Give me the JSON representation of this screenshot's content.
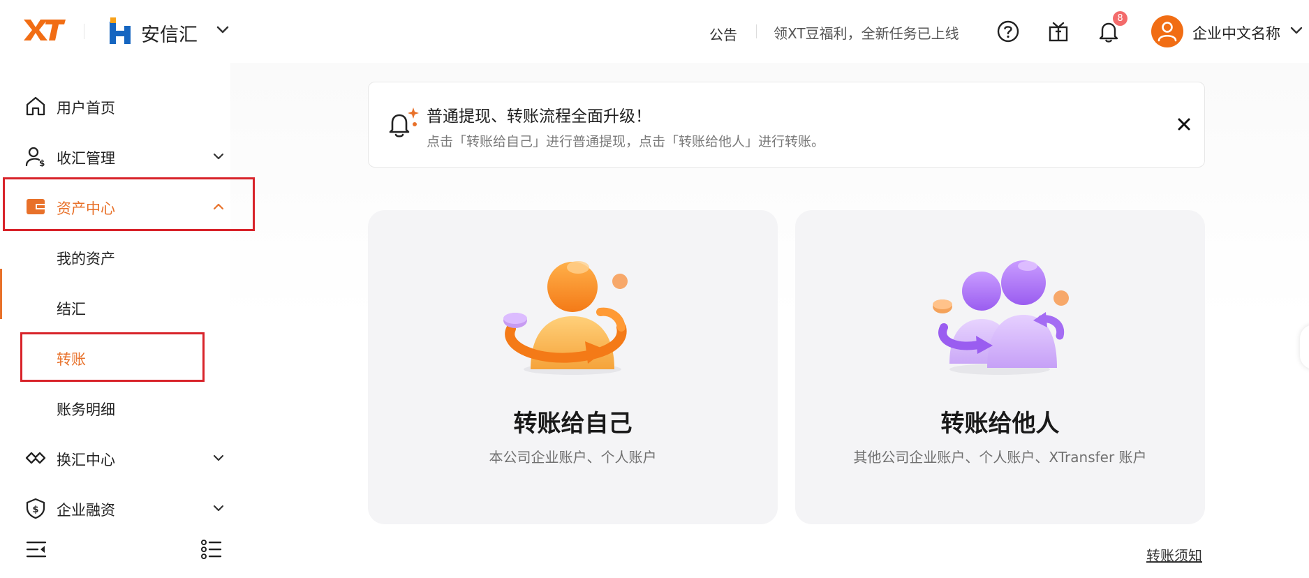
{
  "header": {
    "logo_text": "XT",
    "brand_name": "安信汇",
    "notice_link": "公告",
    "promo_link": "领XT豆福利，全新任务已上线",
    "notification_count": "8",
    "company_name": "企业中文名称"
  },
  "icons": {
    "help": "question-circle-icon",
    "gift": "gift-icon",
    "notifications": "bell-icon",
    "avatar": "user-icon"
  },
  "sidebar": {
    "items": [
      {
        "label": "用户首页",
        "icon": "home-icon"
      },
      {
        "label": "收汇管理",
        "icon": "user-dollar-icon",
        "expandable": true
      },
      {
        "label": "资产中心",
        "icon": "wallet-icon",
        "expanded": true,
        "active": true
      },
      {
        "label": "换汇中心",
        "icon": "exchange-icon",
        "expandable": true
      },
      {
        "label": "企业融资",
        "icon": "shield-dollar-icon",
        "expandable": true
      }
    ],
    "asset_center_sub": [
      {
        "label": "我的资产"
      },
      {
        "label": "结汇"
      },
      {
        "label": "转账",
        "active": true
      },
      {
        "label": "账务明细"
      }
    ]
  },
  "banner": {
    "title": "普通提现、转账流程全面升级！",
    "description": "点击「转账给自己」进行普通提现，点击「转账给他人」进行转账。"
  },
  "cards": [
    {
      "title": "转账给自己",
      "subtitle": "本公司企业账户、个人账户"
    },
    {
      "title": "转账给他人",
      "subtitle": "其他公司企业账户、个人账户、XTransfer 账户"
    }
  ],
  "footer": {
    "transfer_notice": "转账须知"
  },
  "colors": {
    "accent": "#e8712a",
    "brand_orange": "#f16d14",
    "highlight_box": "#d8232a",
    "badge": "#f36b6b",
    "card_bg": "#f4f4f6"
  }
}
